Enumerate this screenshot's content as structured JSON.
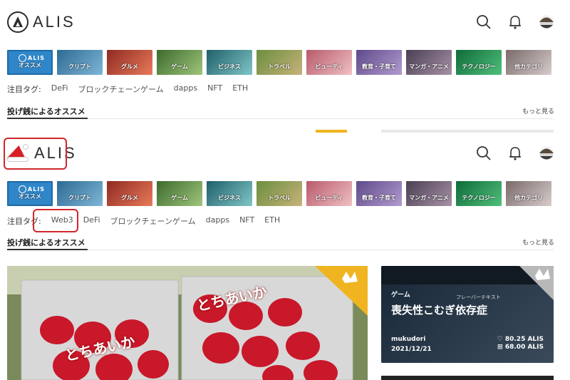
{
  "brand": {
    "name": "ALIS"
  },
  "categories": [
    {
      "label": "オススメ",
      "active": true
    },
    {
      "label": "クリプト",
      "color": "#3a78a0"
    },
    {
      "label": "グルメ",
      "color": "#c2413a"
    },
    {
      "label": "ゲーム",
      "color": "#4f8a3e"
    },
    {
      "label": "ビジネス",
      "color": "#2f7d8c"
    },
    {
      "label": "トラベル",
      "color": "#5f8f4d"
    },
    {
      "label": "ビューティ",
      "color": "#c2707a"
    },
    {
      "label": "教育・子育て",
      "color": "#7f5f9a"
    },
    {
      "label": "マンガ・アニメ",
      "color": "#6b5a6e"
    },
    {
      "label": "テクノロジー",
      "color": "#1f8a4c"
    },
    {
      "label": "他カテゴリ",
      "color": "#8a7a7a"
    }
  ],
  "top": {
    "tags_title": "注目タグ:",
    "tags": [
      "DeFi",
      "ブロックチェーンゲーム",
      "dapps",
      "NFT",
      "ETH"
    ]
  },
  "bottom": {
    "tags_title": "注目タグ:",
    "tags": [
      "Web3",
      "DeFi",
      "ブロックチェーンゲーム",
      "dapps",
      "NFT",
      "ETH"
    ]
  },
  "section": {
    "title": "投げ銭によるオススメ",
    "more": "もっと見る"
  },
  "main_card": {
    "caption_1": "とちあいか",
    "caption_2": "とちあいか"
  },
  "side_card": {
    "category": "ゲーム",
    "title": "喪失性こむぎ依存症",
    "flavor_label": "フレーバーテキスト",
    "author": "mukudori",
    "date": "2021/12/21",
    "likes": "80.25 ALIS",
    "tokens": "68.00 ALIS"
  },
  "colors": {
    "accent": "#2f86c8",
    "highlight": "#d0262c",
    "badge": "#f0b420"
  }
}
